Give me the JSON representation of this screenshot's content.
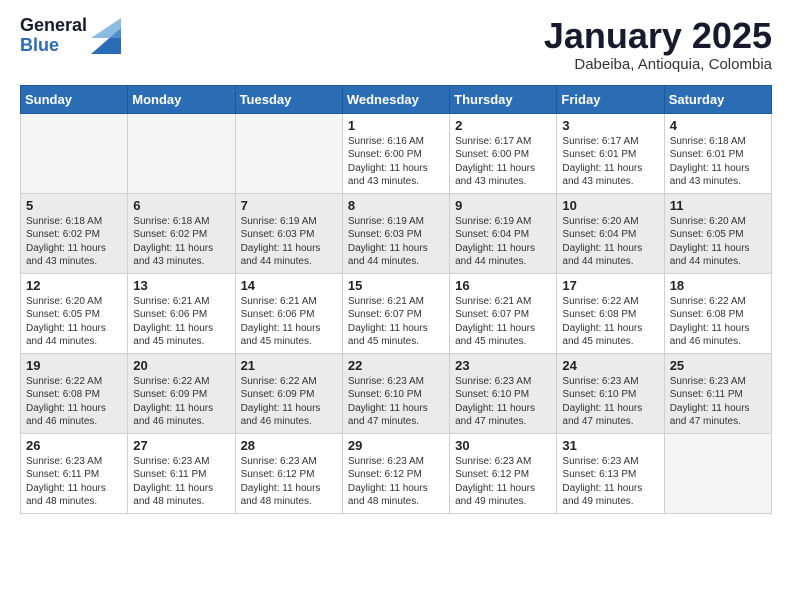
{
  "header": {
    "logo": {
      "line1": "General",
      "line2": "Blue"
    },
    "title": "January 2025",
    "subtitle": "Dabeiba, Antioquia, Colombia"
  },
  "calendar": {
    "weekdays": [
      "Sunday",
      "Monday",
      "Tuesday",
      "Wednesday",
      "Thursday",
      "Friday",
      "Saturday"
    ],
    "weeks": [
      [
        {
          "day": "",
          "info": ""
        },
        {
          "day": "",
          "info": ""
        },
        {
          "day": "",
          "info": ""
        },
        {
          "day": "1",
          "info": "Sunrise: 6:16 AM\nSunset: 6:00 PM\nDaylight: 11 hours\nand 43 minutes."
        },
        {
          "day": "2",
          "info": "Sunrise: 6:17 AM\nSunset: 6:00 PM\nDaylight: 11 hours\nand 43 minutes."
        },
        {
          "day": "3",
          "info": "Sunrise: 6:17 AM\nSunset: 6:01 PM\nDaylight: 11 hours\nand 43 minutes."
        },
        {
          "day": "4",
          "info": "Sunrise: 6:18 AM\nSunset: 6:01 PM\nDaylight: 11 hours\nand 43 minutes."
        }
      ],
      [
        {
          "day": "5",
          "info": "Sunrise: 6:18 AM\nSunset: 6:02 PM\nDaylight: 11 hours\nand 43 minutes."
        },
        {
          "day": "6",
          "info": "Sunrise: 6:18 AM\nSunset: 6:02 PM\nDaylight: 11 hours\nand 43 minutes."
        },
        {
          "day": "7",
          "info": "Sunrise: 6:19 AM\nSunset: 6:03 PM\nDaylight: 11 hours\nand 44 minutes."
        },
        {
          "day": "8",
          "info": "Sunrise: 6:19 AM\nSunset: 6:03 PM\nDaylight: 11 hours\nand 44 minutes."
        },
        {
          "day": "9",
          "info": "Sunrise: 6:19 AM\nSunset: 6:04 PM\nDaylight: 11 hours\nand 44 minutes."
        },
        {
          "day": "10",
          "info": "Sunrise: 6:20 AM\nSunset: 6:04 PM\nDaylight: 11 hours\nand 44 minutes."
        },
        {
          "day": "11",
          "info": "Sunrise: 6:20 AM\nSunset: 6:05 PM\nDaylight: 11 hours\nand 44 minutes."
        }
      ],
      [
        {
          "day": "12",
          "info": "Sunrise: 6:20 AM\nSunset: 6:05 PM\nDaylight: 11 hours\nand 44 minutes."
        },
        {
          "day": "13",
          "info": "Sunrise: 6:21 AM\nSunset: 6:06 PM\nDaylight: 11 hours\nand 45 minutes."
        },
        {
          "day": "14",
          "info": "Sunrise: 6:21 AM\nSunset: 6:06 PM\nDaylight: 11 hours\nand 45 minutes."
        },
        {
          "day": "15",
          "info": "Sunrise: 6:21 AM\nSunset: 6:07 PM\nDaylight: 11 hours\nand 45 minutes."
        },
        {
          "day": "16",
          "info": "Sunrise: 6:21 AM\nSunset: 6:07 PM\nDaylight: 11 hours\nand 45 minutes."
        },
        {
          "day": "17",
          "info": "Sunrise: 6:22 AM\nSunset: 6:08 PM\nDaylight: 11 hours\nand 45 minutes."
        },
        {
          "day": "18",
          "info": "Sunrise: 6:22 AM\nSunset: 6:08 PM\nDaylight: 11 hours\nand 46 minutes."
        }
      ],
      [
        {
          "day": "19",
          "info": "Sunrise: 6:22 AM\nSunset: 6:08 PM\nDaylight: 11 hours\nand 46 minutes."
        },
        {
          "day": "20",
          "info": "Sunrise: 6:22 AM\nSunset: 6:09 PM\nDaylight: 11 hours\nand 46 minutes."
        },
        {
          "day": "21",
          "info": "Sunrise: 6:22 AM\nSunset: 6:09 PM\nDaylight: 11 hours\nand 46 minutes."
        },
        {
          "day": "22",
          "info": "Sunrise: 6:23 AM\nSunset: 6:10 PM\nDaylight: 11 hours\nand 47 minutes."
        },
        {
          "day": "23",
          "info": "Sunrise: 6:23 AM\nSunset: 6:10 PM\nDaylight: 11 hours\nand 47 minutes."
        },
        {
          "day": "24",
          "info": "Sunrise: 6:23 AM\nSunset: 6:10 PM\nDaylight: 11 hours\nand 47 minutes."
        },
        {
          "day": "25",
          "info": "Sunrise: 6:23 AM\nSunset: 6:11 PM\nDaylight: 11 hours\nand 47 minutes."
        }
      ],
      [
        {
          "day": "26",
          "info": "Sunrise: 6:23 AM\nSunset: 6:11 PM\nDaylight: 11 hours\nand 48 minutes."
        },
        {
          "day": "27",
          "info": "Sunrise: 6:23 AM\nSunset: 6:11 PM\nDaylight: 11 hours\nand 48 minutes."
        },
        {
          "day": "28",
          "info": "Sunrise: 6:23 AM\nSunset: 6:12 PM\nDaylight: 11 hours\nand 48 minutes."
        },
        {
          "day": "29",
          "info": "Sunrise: 6:23 AM\nSunset: 6:12 PM\nDaylight: 11 hours\nand 48 minutes."
        },
        {
          "day": "30",
          "info": "Sunrise: 6:23 AM\nSunset: 6:12 PM\nDaylight: 11 hours\nand 49 minutes."
        },
        {
          "day": "31",
          "info": "Sunrise: 6:23 AM\nSunset: 6:13 PM\nDaylight: 11 hours\nand 49 minutes."
        },
        {
          "day": "",
          "info": ""
        }
      ]
    ]
  }
}
